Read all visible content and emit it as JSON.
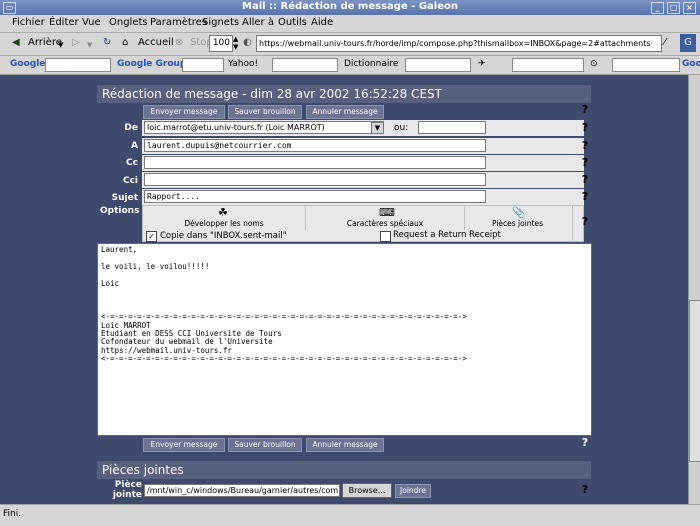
{
  "window": {
    "title": "Mail :: Rédaction de message - Galeon"
  },
  "menu": [
    "Fichier",
    "Éditer",
    "Vue",
    "Onglets",
    "Paramètres",
    "Signets",
    "Aller à",
    "Outils",
    "Aide"
  ],
  "nav": {
    "back": "Arrière",
    "stop": "Stop",
    "home": "Accueil",
    "zoom": "100",
    "url": "https://webmail.univ-tours.fr/horde/imp/compose.php?thismailbox=INBOX&page=2#attachments"
  },
  "search": {
    "google": "Google",
    "groups": "Google Groups",
    "yahoo": "Yahoo!",
    "dict": "Dictionnaire",
    "google2": "Google"
  },
  "compose": {
    "title": "Rédaction de message - dim 28 avr 2002 16:52:28 CEST",
    "buttons": {
      "send": "Envoyer message",
      "save": "Sauver brouillon",
      "cancel": "Annuler message"
    },
    "labels": {
      "from": "De",
      "to": "A",
      "cc": "Cc",
      "bcc": "Cci",
      "subject": "Sujet",
      "options": "Options",
      "ou": "ou:"
    },
    "from_value": "loic.marrot@etu.univ-tours.fr (Loic MARROT)",
    "to_value": "laurent.dupuis@netcourrier.com",
    "cc_value": "",
    "bcc_value": "",
    "subject_value": "Rapport....",
    "options": {
      "expand": "Développer les noms",
      "special": "Caractères spéciaux",
      "attach": "Pièces jointes",
      "copy": "Copie dans \"INBOX.sent-mail\"",
      "receipt": "Request a Return Receipt"
    },
    "body": "Laurent,\n\nle voili, le voilou!!!!!\n\nLoic\n\n\n\n<-=-=-=-=-=-=-=-=-=-=-=-=-=-=-=-=-=-=-=-=-=-=-=-=-=-=-=-=-=-=-=-=-=-=-=-=-=-=-=->\nLoic MARROT\nEtudiant en DESS CCI Universite de Tours\nCofondateur du webmail de l'Universite\nhttps://webmail.univ-tours.fr\n<-=-=-=-=-=-=-=-=-=-=-=-=-=-=-=-=-=-=-=-=-=-=-=-=-=-=-=-=-=-=-=-=-=-=-=-=-=-=-=->"
  },
  "attachments": {
    "title": "Pièces jointes",
    "label1": "Pièce",
    "label2": "jointe",
    "path": "/mnt/win_c/windows/Bureau/garnier/autres/compte-",
    "browse": "Browse...",
    "attach": "Joindre"
  },
  "status": {
    "text": "Fini."
  }
}
